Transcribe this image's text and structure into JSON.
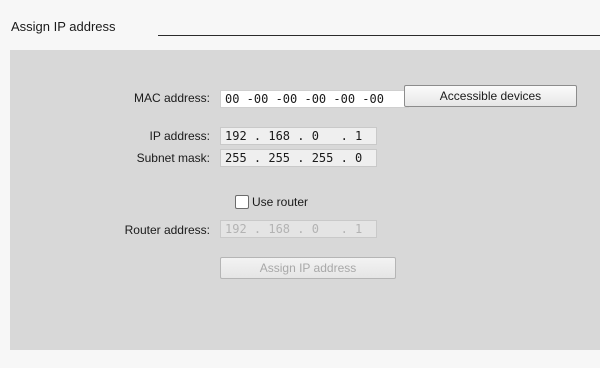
{
  "section": {
    "title": "Assign IP address"
  },
  "mac": {
    "label": "MAC address:",
    "value": "00 -00 -00 -00 -00 -00"
  },
  "accessible_devices_button": "Accessible devices",
  "ip": {
    "label": "IP address:",
    "value": "192 . 168 . 0   . 1"
  },
  "subnet": {
    "label": "Subnet mask:",
    "value": "255 . 255 . 255 . 0"
  },
  "use_router": {
    "label": "Use router",
    "checked": false
  },
  "router": {
    "label": "Router address:",
    "value": "192 . 168 . 0   . 1"
  },
  "assign_button": "Assign IP address"
}
